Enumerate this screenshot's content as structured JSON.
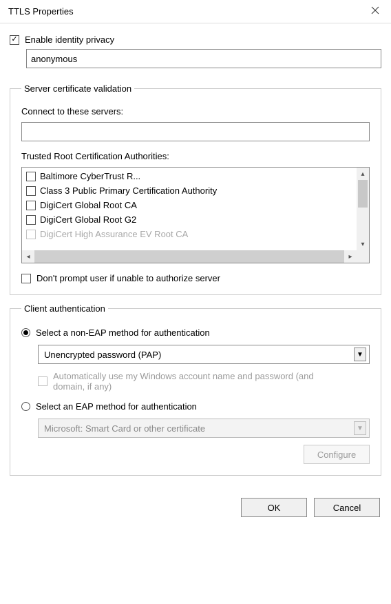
{
  "window": {
    "title": "TTLS Properties"
  },
  "identity": {
    "enable_label": "Enable identity privacy",
    "enabled": true,
    "value": "anonymous"
  },
  "server_validation": {
    "legend": "Server certificate validation",
    "connect_label": "Connect to these servers:",
    "connect_value": "",
    "ca_label": "Trusted Root Certification Authorities:",
    "ca_list": [
      {
        "label": "Baltimore CyberTrust R...",
        "checked": false
      },
      {
        "label": "Class 3 Public Primary Certification Authority",
        "checked": false
      },
      {
        "label": "DigiCert Global Root CA",
        "checked": false
      },
      {
        "label": "DigiCert Global Root G2",
        "checked": false
      },
      {
        "label": "DigiCert High Assurance EV Root CA",
        "checked": false
      }
    ],
    "dont_prompt_label": "Don't prompt user if unable to authorize server",
    "dont_prompt_checked": false
  },
  "client_auth": {
    "legend": "Client authentication",
    "non_eap": {
      "radio_label": "Select a non-EAP method for authentication",
      "selected": true,
      "dropdown_value": "Unencrypted password (PAP)",
      "auto_label": "Automatically use my Windows account name and password (and domain, if any)",
      "auto_checked": false
    },
    "eap": {
      "radio_label": "Select an EAP method for authentication",
      "selected": false,
      "dropdown_value": "Microsoft: Smart Card or other certificate",
      "configure_label": "Configure"
    }
  },
  "footer": {
    "ok": "OK",
    "cancel": "Cancel"
  }
}
